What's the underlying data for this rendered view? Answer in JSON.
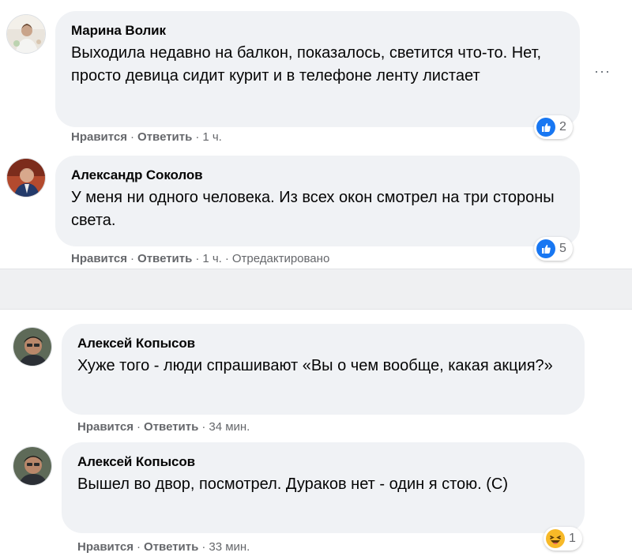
{
  "comments_top": [
    {
      "author": "Марина Волик",
      "text": "Выходила недавно на балкон, показалось, светится что-то. Нет, просто девица сидит курит и в телефоне ленту листает",
      "like": "Нравится",
      "reply": "Ответить",
      "time": "1 ч.",
      "reaction_icon": "like-icon",
      "reaction_count": "2"
    },
    {
      "author": "Александр Соколов",
      "text": "У меня ни одного человека. Из всех окон смотрел на три стороны света.",
      "like": "Нравится",
      "reply": "Ответить",
      "time": "1 ч.",
      "edited": "Отредактировано",
      "reaction_icon": "like-icon",
      "reaction_count": "5"
    }
  ],
  "comments_bottom": [
    {
      "author": "Алексей Копысов",
      "text": "Хуже того - люди спрашивают «Вы о чем вообще, какая акция?»",
      "like": "Нравится",
      "reply": "Ответить",
      "time": "34 мин."
    },
    {
      "author": "Алексей Копысов",
      "text": "Вышел во двор, посмотрел. Дураков нет - один я стою. (С)",
      "like": "Нравится",
      "reply": "Ответить",
      "time": "33 мин.",
      "reaction_icon": "haha-icon",
      "reaction_count": "1"
    }
  ],
  "menu": {
    "more_label": "···"
  },
  "colors": {
    "bubble": "#f0f2f5",
    "meta_text": "#65676b",
    "like_blue": "#1877f2",
    "haha_yellow": "#f7b928",
    "divider": "#eff0f2"
  }
}
